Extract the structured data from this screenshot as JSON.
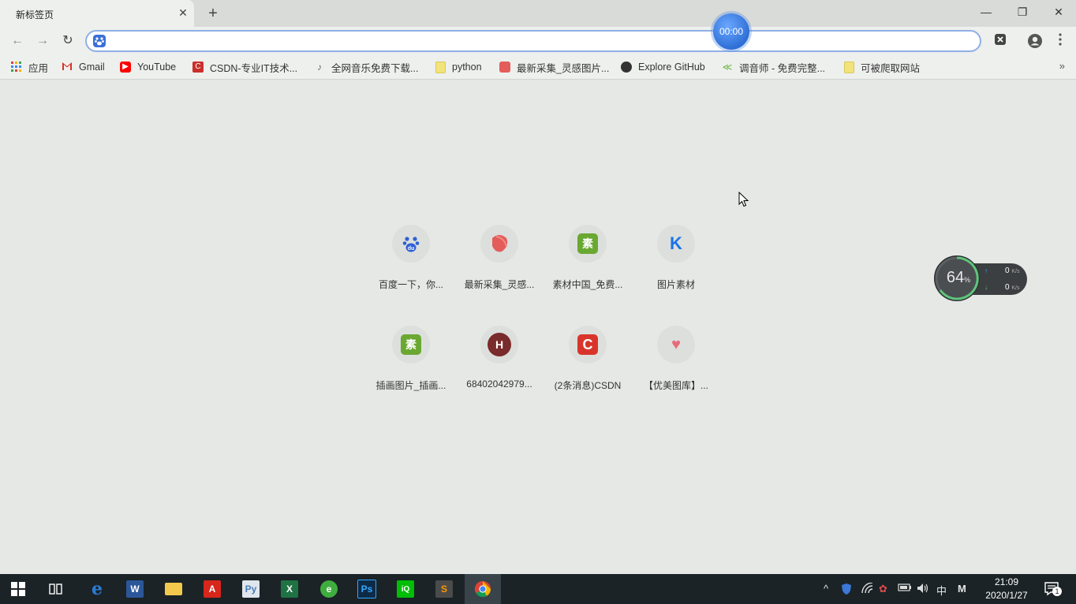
{
  "browser": {
    "tab_title": "新标签页",
    "tab_close": "✕",
    "new_tab": "+",
    "window_controls": {
      "minimize": "—",
      "restore": "❐",
      "close": "✕"
    },
    "timer": "00:00",
    "nav": {
      "back": "←",
      "forward": "→",
      "reload": "↻"
    },
    "omnibox": {
      "value": "",
      "placeholder": ""
    }
  },
  "bookmarks": {
    "items": [
      {
        "label": "应用",
        "icon": "apps-grid-icon",
        "color": "#4285f4"
      },
      {
        "label": "Gmail",
        "icon": "gmail-icon",
        "color": "#d93025"
      },
      {
        "label": "YouTube",
        "icon": "youtube-icon",
        "color": "#ff0000"
      },
      {
        "label": "CSDN-专业IT技术...",
        "icon": "csdn-icon",
        "color": "#c9302c"
      },
      {
        "label": "全网音乐免费下载...",
        "icon": "music-icon",
        "color": "#777777"
      },
      {
        "label": "python",
        "icon": "folder-icon",
        "color": "#f2e47a"
      },
      {
        "label": "最新采集_灵感图片...",
        "icon": "huaban-icon",
        "color": "#e35d5b"
      },
      {
        "label": "Explore GitHub",
        "icon": "github-icon",
        "color": "#333333"
      },
      {
        "label": "调音师 - 免费完整...",
        "icon": "leaf-icon",
        "color": "#6bb33a"
      },
      {
        "label": "可被爬取网站",
        "icon": "folder-icon",
        "color": "#f2e47a"
      }
    ],
    "more": "»"
  },
  "shortcuts": [
    {
      "label": "百度一下，你...",
      "logo_text": "du",
      "icon": "baidu-paw-icon",
      "color": "#2f5fd6"
    },
    {
      "label": "最新采集_灵感...",
      "logo_text": "",
      "icon": "huaban-icon",
      "color": "#e35d5b"
    },
    {
      "label": "素材中国_免费...",
      "logo_text": "素",
      "icon": "sucai-icon",
      "color": "#6aa832"
    },
    {
      "label": "图片素材",
      "logo_text": "K",
      "icon": "k-logo-icon",
      "color": "#1a73e8"
    },
    {
      "label": "插画图片_插画...",
      "logo_text": "素",
      "icon": "sucai-icon",
      "color": "#6aa832"
    },
    {
      "label": "68402042979...",
      "logo_text": "H",
      "icon": "h-letter-icon",
      "color": "#7a2b2b"
    },
    {
      "label": "(2条消息)CSDN",
      "logo_text": "C",
      "icon": "csdn-icon",
      "color": "#d9342b"
    },
    {
      "label": "【优美图库】...",
      "logo_text": "♥",
      "icon": "heart-icon",
      "color": "#e86b7a"
    }
  ],
  "net_widget": {
    "percent": "64",
    "percent_sign": "%",
    "up_value": "0",
    "down_value": "0",
    "unit": "K/s"
  },
  "taskbar": {
    "apps": [
      {
        "name": "start",
        "text": "⊞",
        "color": "transparent"
      },
      {
        "name": "task-view",
        "text": "⧉",
        "color": "transparent"
      },
      {
        "name": "edge",
        "text": "e",
        "color": "#1f6fd1"
      },
      {
        "name": "word",
        "text": "W",
        "color": "#2b579a"
      },
      {
        "name": "file-explorer",
        "text": "",
        "color": "#f2c94c"
      },
      {
        "name": "acrobat",
        "text": "A",
        "color": "#d7261b"
      },
      {
        "name": "python",
        "text": "Py",
        "color": "#4a7db5"
      },
      {
        "name": "excel",
        "text": "X",
        "color": "#1f7244"
      },
      {
        "name": "iqiyi-circle",
        "text": "",
        "color": "#3fae3f"
      },
      {
        "name": "photoshop",
        "text": "Ps",
        "color": "#0d2a47"
      },
      {
        "name": "iqiyi",
        "text": "iQ",
        "color": "#00be06"
      },
      {
        "name": "sublime",
        "text": "S",
        "color": "#ff9800"
      },
      {
        "name": "chrome",
        "text": "",
        "color": "#ffffff"
      }
    ],
    "tray": {
      "chevron": "^",
      "ime": "中",
      "ime_mode": "M"
    },
    "time": "21:09",
    "date": "2020/1/27",
    "notification_count": "1"
  }
}
